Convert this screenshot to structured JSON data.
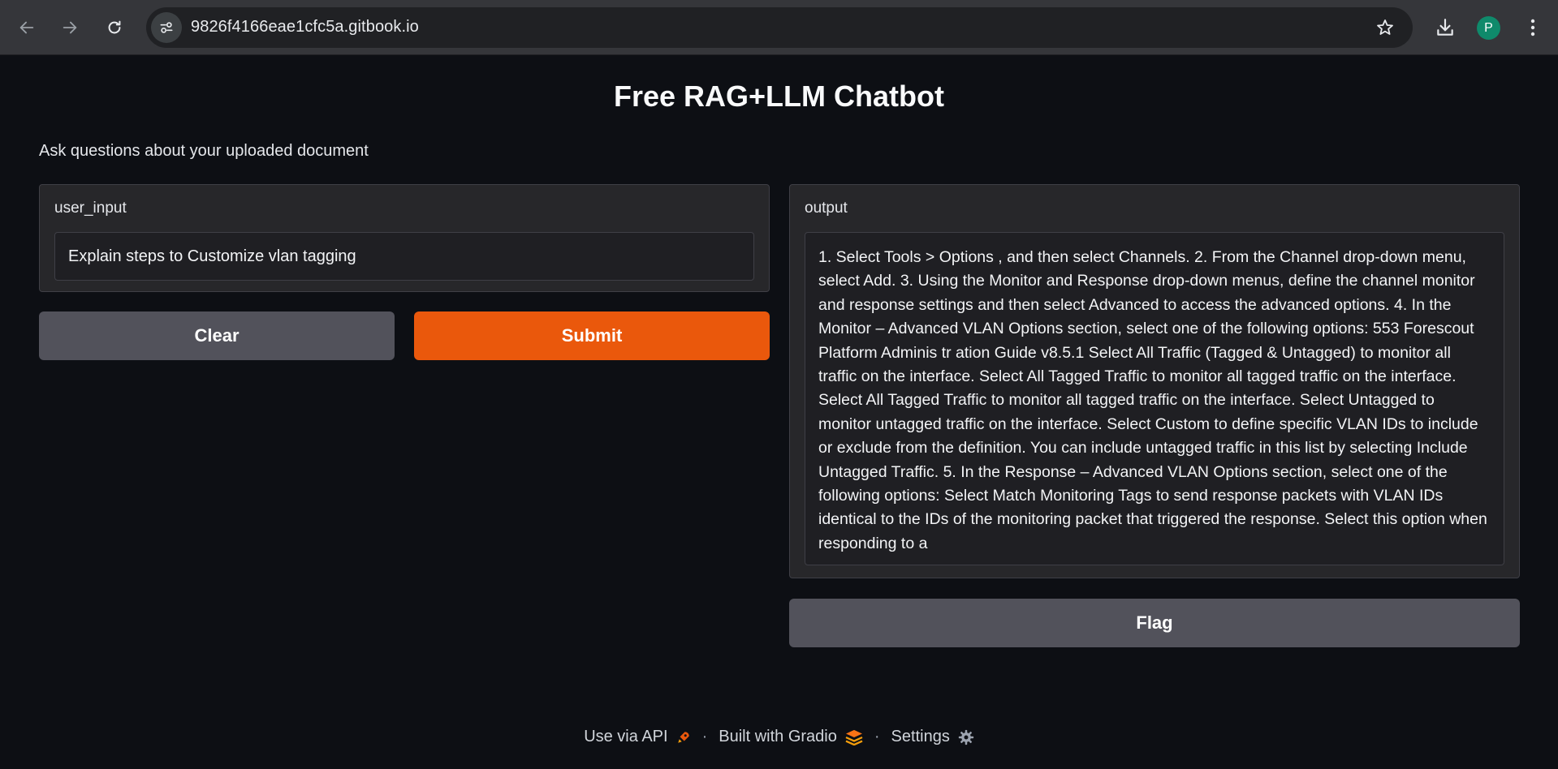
{
  "browser": {
    "url": "9826f4166eae1cfc5a.gitbook.io",
    "profile_initial": "P",
    "icons": {
      "back": "arrow-left-icon",
      "forward": "arrow-right-icon",
      "reload": "reload-icon",
      "site_info": "site-settings-icon",
      "bookmark": "star-icon",
      "download": "download-icon",
      "menu": "kebab-menu-icon"
    }
  },
  "app": {
    "title": "Free RAG+LLM Chatbot",
    "description": "Ask questions about your uploaded document"
  },
  "input": {
    "label": "user_input",
    "value": "Explain steps to Customize vlan tagging"
  },
  "buttons": {
    "clear": "Clear",
    "submit": "Submit",
    "flag": "Flag"
  },
  "output": {
    "label": "output",
    "value": "1. Select Tools > Options , and then select Channels. 2. From the Channel drop-down menu, select Add. 3. Using the Monitor and Response drop-down menus, define the channel monitor and response settings and then select Advanced to access the advanced options. 4. In the Monitor – Advanced VLAN Options section, select one of the following options: 553 Forescout Platform Adminis tr ation Guide v8.5.1  Select All Traffic (Tagged & Untagged) to monitor all traffic on the interface.  Select All Tagged Traffic to monitor all tagged traffic on the interface. Select All Tagged Traffic to monitor all tagged traffic on the interface.  Select Untagged to monitor untagged traffic on the interface.  Select Custom to define specific VLAN IDs to include or exclude from the definition. You can include untagged traffic in this list by selecting Include Untagged Traffic. 5. In the Response – Advanced VLAN Options section, select one of the following options:  Select Match Monitoring Tags to send response packets with VLAN IDs identical to the IDs of the monitoring packet that triggered the response. Select this option when responding to a"
  },
  "footer": {
    "api": "Use via API",
    "built": "Built with Gradio",
    "settings": "Settings",
    "separator": "·"
  },
  "colors": {
    "accent": "#ea580c",
    "secondary_button": "#52525b",
    "background": "#0d0f14",
    "panel": "#27272a"
  }
}
